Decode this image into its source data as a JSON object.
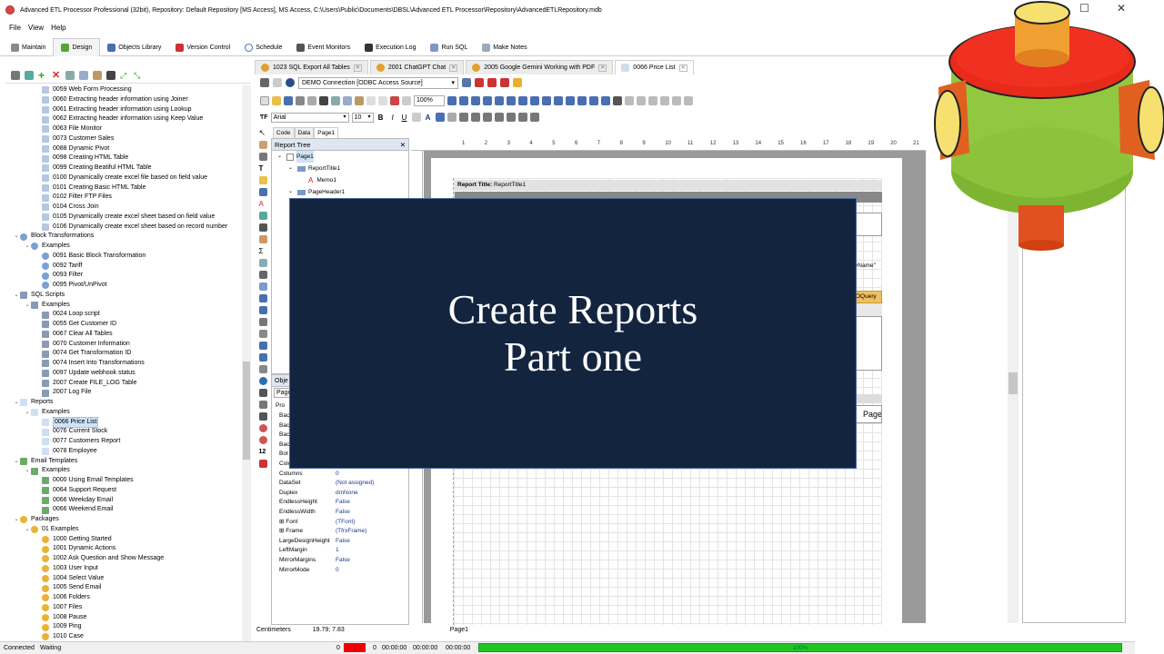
{
  "window": {
    "title": "Advanced ETL Processor Professional (32bit), Repository: Default Repository  [MS Access], MS Access, C:\\Users\\Public\\Documents\\DBSL\\Advanced ETL Processor\\Repository\\AdvancedETLRepository.mdb",
    "min": "—",
    "max": "☐",
    "close": "✕"
  },
  "menu": [
    "File",
    "View",
    "Help"
  ],
  "ribbon_tabs": [
    "Maintain",
    "Design",
    "Objects Library",
    "Version Control",
    "Schedule",
    "Event Monitors",
    "Execution Log",
    "Run SQL",
    "Make Notes"
  ],
  "tree": [
    {
      "label": "0059 Web Form Processing",
      "level": 3,
      "icon": "document-icon"
    },
    {
      "label": "0060 Extracting header information using Joiner",
      "level": 3,
      "icon": "document-icon"
    },
    {
      "label": "0061 Extracting header information using Lookup",
      "level": 3,
      "icon": "document-icon"
    },
    {
      "label": "0062 Extracting header information using Keep Value",
      "level": 3,
      "icon": "document-icon"
    },
    {
      "label": "0063 File Monitor",
      "level": 3,
      "icon": "document-icon"
    },
    {
      "label": "0073 Customer Sales",
      "level": 3,
      "icon": "document-icon"
    },
    {
      "label": "0088 Dynamic Pivot",
      "level": 3,
      "icon": "document-icon"
    },
    {
      "label": "0098 Creating HTML Table",
      "level": 3,
      "icon": "document-icon"
    },
    {
      "label": "0099 Creating Beatiful HTML Table",
      "level": 3,
      "icon": "document-icon"
    },
    {
      "label": "0100 Dynamically create excel file based on field value",
      "level": 3,
      "icon": "document-icon"
    },
    {
      "label": "0101 Creating Basic HTML Table",
      "level": 3,
      "icon": "document-icon"
    },
    {
      "label": "0102 Filter FTP Files",
      "level": 3,
      "icon": "document-icon"
    },
    {
      "label": "0104 Cross Join",
      "level": 3,
      "icon": "document-icon"
    },
    {
      "label": "0105 Dynamically create excel sheet based on field value",
      "level": 3,
      "icon": "document-icon"
    },
    {
      "label": "0106 Dynamically create excel sheet based on record number",
      "level": 3,
      "icon": "document-icon"
    },
    {
      "label": "Block Transformations",
      "level": 1,
      "icon": "block-icon",
      "toggle": "⌄"
    },
    {
      "label": "Examples",
      "level": 2,
      "icon": "block-icon",
      "toggle": "⌄"
    },
    {
      "label": "0091 Basic Block Transformation",
      "level": 3,
      "icon": "block-icon"
    },
    {
      "label": "0092 Tariff",
      "level": 3,
      "icon": "block-icon"
    },
    {
      "label": "0093 Filter",
      "level": 3,
      "icon": "block-icon"
    },
    {
      "label": "0095 Pivot/UnPivot",
      "level": 3,
      "icon": "block-icon"
    },
    {
      "label": "SQL Scripts",
      "level": 1,
      "icon": "sql-icon",
      "toggle": "⌄"
    },
    {
      "label": "Examples",
      "level": 2,
      "icon": "sql-icon",
      "toggle": "⌄"
    },
    {
      "label": "0024 Loop script",
      "level": 3,
      "icon": "sql-icon"
    },
    {
      "label": "0055 Get Customer ID",
      "level": 3,
      "icon": "sql-icon"
    },
    {
      "label": "0067 Clear All Tables",
      "level": 3,
      "icon": "sql-icon"
    },
    {
      "label": "0070 Customer Information",
      "level": 3,
      "icon": "sql-icon"
    },
    {
      "label": "0074 Get Transformation ID",
      "level": 3,
      "icon": "sql-icon"
    },
    {
      "label": "0074 Insert Into Transformations",
      "level": 3,
      "icon": "sql-icon"
    },
    {
      "label": "0097 Update webhook status",
      "level": 3,
      "icon": "sql-icon"
    },
    {
      "label": "2007 Create FILE_LOG Table",
      "level": 3,
      "icon": "sql-icon"
    },
    {
      "label": "2007 Log File",
      "level": 3,
      "icon": "sql-icon"
    },
    {
      "label": "Reports",
      "level": 1,
      "icon": "report-icon",
      "toggle": "⌄"
    },
    {
      "label": "Examples",
      "level": 2,
      "icon": "report-icon",
      "toggle": "⌄"
    },
    {
      "label": "0066 Price List",
      "level": 3,
      "icon": "report-icon",
      "selected": true
    },
    {
      "label": "0076 Current Stock",
      "level": 3,
      "icon": "report-icon"
    },
    {
      "label": "0077 Customers Report",
      "level": 3,
      "icon": "report-icon"
    },
    {
      "label": "0078 Employee",
      "level": 3,
      "icon": "report-icon"
    },
    {
      "label": "Email Templates",
      "level": 1,
      "icon": "email-icon",
      "toggle": "⌄"
    },
    {
      "label": "Examples",
      "level": 2,
      "icon": "email-icon",
      "toggle": "⌄"
    },
    {
      "label": "0000 Using Email Templates",
      "level": 3,
      "icon": "email-icon"
    },
    {
      "label": "0064 Support Request",
      "level": 3,
      "icon": "email-icon"
    },
    {
      "label": "0066 Weekday Email",
      "level": 3,
      "icon": "email-icon"
    },
    {
      "label": "0066 Weekend Email",
      "level": 3,
      "icon": "email-icon"
    },
    {
      "label": "Packages",
      "level": 1,
      "icon": "package-icon",
      "toggle": "⌄"
    },
    {
      "label": "01 Examples",
      "level": 2,
      "icon": "package-icon",
      "toggle": "⌄"
    },
    {
      "label": "1000 Getting Started",
      "level": 3,
      "icon": "package-icon"
    },
    {
      "label": "1001 Dynamic Actions",
      "level": 3,
      "icon": "package-icon"
    },
    {
      "label": "1002 Ask Question and Show Message",
      "level": 3,
      "icon": "package-icon"
    },
    {
      "label": "1003 User Input",
      "level": 3,
      "icon": "package-icon"
    },
    {
      "label": "1004 Select Value",
      "level": 3,
      "icon": "package-icon"
    },
    {
      "label": "1005 Send Email",
      "level": 3,
      "icon": "package-icon"
    },
    {
      "label": "1006 Folders",
      "level": 3,
      "icon": "package-icon"
    },
    {
      "label": "1007 Files",
      "level": 3,
      "icon": "package-icon"
    },
    {
      "label": "1008 Pause",
      "level": 3,
      "icon": "package-icon"
    },
    {
      "label": "1009 Ping",
      "level": 3,
      "icon": "package-icon"
    },
    {
      "label": "1010 Case",
      "level": 3,
      "icon": "package-icon"
    }
  ],
  "doc_tabs": [
    {
      "label": "1023 SQL Export All Tables"
    },
    {
      "label": "2001 ChatGPT Chat"
    },
    {
      "label": "2005 Google Gemini Working with PDF"
    },
    {
      "label": "0066 Price List",
      "active": true
    }
  ],
  "connection": "DEMO Connection [ODBC Access Source]",
  "zoom": "100%",
  "font": {
    "name": "Arial",
    "size": "10"
  },
  "design_tabs": [
    "Code",
    "Data",
    "Page1"
  ],
  "report_tree": {
    "title": "Report Tree",
    "close": "✕",
    "nodes": [
      {
        "label": "Page1",
        "level": 0
      },
      {
        "label": "ReportTitle1",
        "level": 1
      },
      {
        "label": "Memo1",
        "level": 2
      },
      {
        "label": "PageHeader1",
        "level": 1
      }
    ]
  },
  "object_inspector": {
    "title": "Obje",
    "selector": "Page",
    "tab": "Pro",
    "props": [
      {
        "name": "Bac",
        "value": ""
      },
      {
        "name": "Bac",
        "value": ""
      },
      {
        "name": "Bac",
        "value": ""
      },
      {
        "name": "Bac",
        "value": ""
      },
      {
        "name": "Bot",
        "value": ""
      },
      {
        "name": "Color",
        "value": "clNone"
      },
      {
        "name": "Columns",
        "value": "0"
      },
      {
        "name": "DataSet",
        "value": "(Not assigned)"
      },
      {
        "name": "Duplex",
        "value": "dmNone"
      },
      {
        "name": "EndlessHeight",
        "value": "False"
      },
      {
        "name": "EndlessWidth",
        "value": "False"
      },
      {
        "name": "⊞ Font",
        "value": "(TFont)"
      },
      {
        "name": "⊞ Frame",
        "value": "(TfrxFrame)"
      },
      {
        "name": "LargeDesignHeight",
        "value": "False"
      },
      {
        "name": "LeftMargin",
        "value": "1"
      },
      {
        "name": "MirrorMargins",
        "value": "False"
      },
      {
        "name": "MirrorMode",
        "value": "0"
      }
    ]
  },
  "ruler_ticks": [
    "1",
    "2",
    "3",
    "4",
    "5",
    "6",
    "7",
    "8",
    "9",
    "10",
    "11",
    "12",
    "13",
    "14",
    "15",
    "16",
    "17",
    "18",
    "19",
    "20",
    "21"
  ],
  "report": {
    "title_band": "Report Title:",
    "title_band_name": "ReportTitle1",
    "frag_name": "yName\"",
    "frag_query": "OQuery",
    "frag_page": "Page"
  },
  "right_fields": [
    "uctName",
    "ntityPerUnit",
    "itPrice"
  ],
  "bottom_status": {
    "units": "Centimeters",
    "coords": "19.79; 7.83",
    "page": "Page1"
  },
  "statusbar": {
    "connected": "Connected",
    "waiting": "Waiting",
    "count": "0",
    "count2": "0",
    "time1": "00:00:00",
    "time2": "00:00:00",
    "time3": "00:00:00",
    "progress": "100%",
    "progress_value": 1.0
  },
  "overlay": {
    "line1": "Create Reports",
    "line2": "Part one",
    "bg_color": "#13243f"
  },
  "colors": {
    "accent": "#1a3b8a",
    "progress": "#22c522",
    "alert": "#e00000",
    "selection": "#cde3f7"
  }
}
